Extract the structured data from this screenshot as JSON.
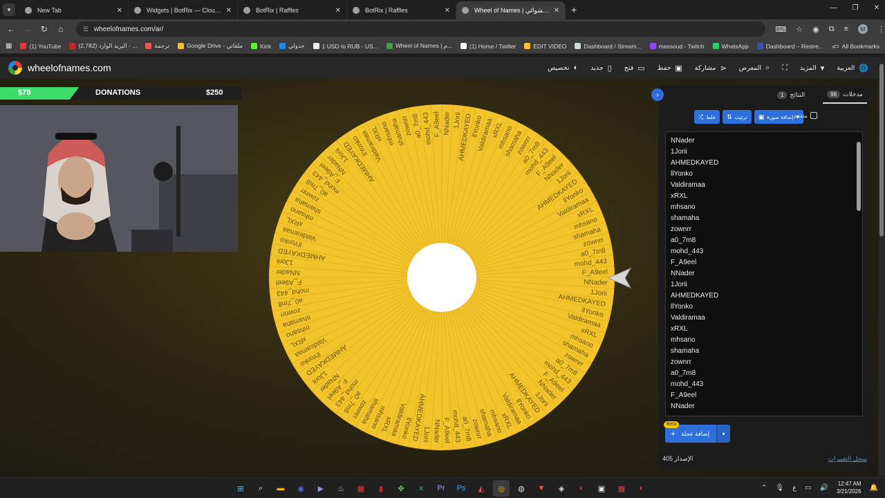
{
  "browser": {
    "tabs": [
      {
        "title": "New Tab",
        "active": false
      },
      {
        "title": "Widgets | BotRix — Cloud Strea",
        "active": false
      },
      {
        "title": "BotRix | Raffles",
        "active": false
      },
      {
        "title": "BotRix | Raffles",
        "active": false
      },
      {
        "title": "Wheel of Names | اسم العشوائي",
        "active": true
      }
    ],
    "url": "wheelofnames.com/ar/",
    "profile_initial": "M",
    "bookmarks": [
      {
        "label": "(1) YouTube",
        "color": "#e53935"
      },
      {
        "label": "(2,782) البريد الوارد - ...",
        "color": "#c62828"
      },
      {
        "label": "ترجمة",
        "color": "#ef5350"
      },
      {
        "label": "Google Drive - ملفاتي",
        "color": "#fbc02d"
      },
      {
        "label": "Kick",
        "color": "#53fc18"
      },
      {
        "label": "جدولي",
        "color": "#1e88e5"
      },
      {
        "label": "1 USD to RUB - US...",
        "color": "#eeeeee"
      },
      {
        "label": "Wheel of Names | م...",
        "color": "#43a047"
      },
      {
        "label": "(1) Home / Twitter",
        "color": "#ffffff"
      },
      {
        "label": "EDIT VIDEO",
        "color": "#fbc02d"
      },
      {
        "label": "Dashboard / Stream...",
        "color": "#cfd8dc"
      },
      {
        "label": "massoud - Twitch",
        "color": "#9146ff"
      },
      {
        "label": "WhatsApp",
        "color": "#25d366"
      },
      {
        "label": "Dashboard – Restre...",
        "color": "#3f51b5"
      }
    ],
    "all_bookmarks": "All Bookmarks"
  },
  "site": {
    "logo": "wheelofnames.com",
    "menu": [
      {
        "label": "العربية",
        "icon": "globe-icon"
      },
      {
        "label": "المزيد",
        "icon": "chevron-down-icon"
      },
      {
        "label": "",
        "icon": "fullscreen-icon"
      },
      {
        "label": "المعرض",
        "icon": "search-icon"
      },
      {
        "label": "مشاركة",
        "icon": "share-icon"
      },
      {
        "label": "حفظ",
        "icon": "save-icon"
      },
      {
        "label": "فتح",
        "icon": "folder-icon"
      },
      {
        "label": "جديد",
        "icon": "file-icon"
      },
      {
        "label": "تخصيص",
        "icon": "palette-icon"
      }
    ]
  },
  "donation": {
    "current": "$78",
    "label": "DONATIONS",
    "goal": "$250",
    "progress": 0.31,
    "color": "#3ddc6b"
  },
  "wheel": {
    "color": "#f2c32a",
    "text_color": "#6b5410",
    "segment_names": [
      "NNader",
      "1Jorii",
      "AHMEDKAYED",
      "llYonko",
      "Valdiramaa",
      "xRXL",
      "mhsano",
      "shamaha",
      "zownrr",
      "a0_7m8",
      "mohd_443",
      "F_A9eel"
    ]
  },
  "panel": {
    "tabs": [
      {
        "label": "مدخلات",
        "count": "96",
        "active": true
      },
      {
        "label": "النتائج",
        "count": "1",
        "active": false
      }
    ],
    "buttons": {
      "shuffle": "خلط",
      "sort": "ترتيب",
      "add_image": "إضافة صورة",
      "advanced": "متقدم"
    },
    "entries": [
      "NNader",
      "1Jorii",
      "AHMEDKAYED",
      "llYonko",
      "Valdiramaa",
      "xRXL",
      "mhsano",
      "shamaha",
      "zownrr",
      "a0_7m8",
      "mohd_443",
      "F_A9eel",
      "NNader",
      "1Jorii",
      "AHMEDKAYED",
      "llYonko",
      "Valdiramaa",
      "xRXL",
      "mhsano",
      "shamaha",
      "zownrr",
      "a0_7m8",
      "mohd_443",
      "F_A9eel",
      "NNader"
    ],
    "add_wheel": "إضافة عجلة",
    "beta": "Beta",
    "version": "الإصدار 405",
    "changelog": "سجل التغييرات"
  },
  "taskbar": {
    "time": "12:47 AM",
    "date": "3/21/2026",
    "lang": "ع"
  }
}
